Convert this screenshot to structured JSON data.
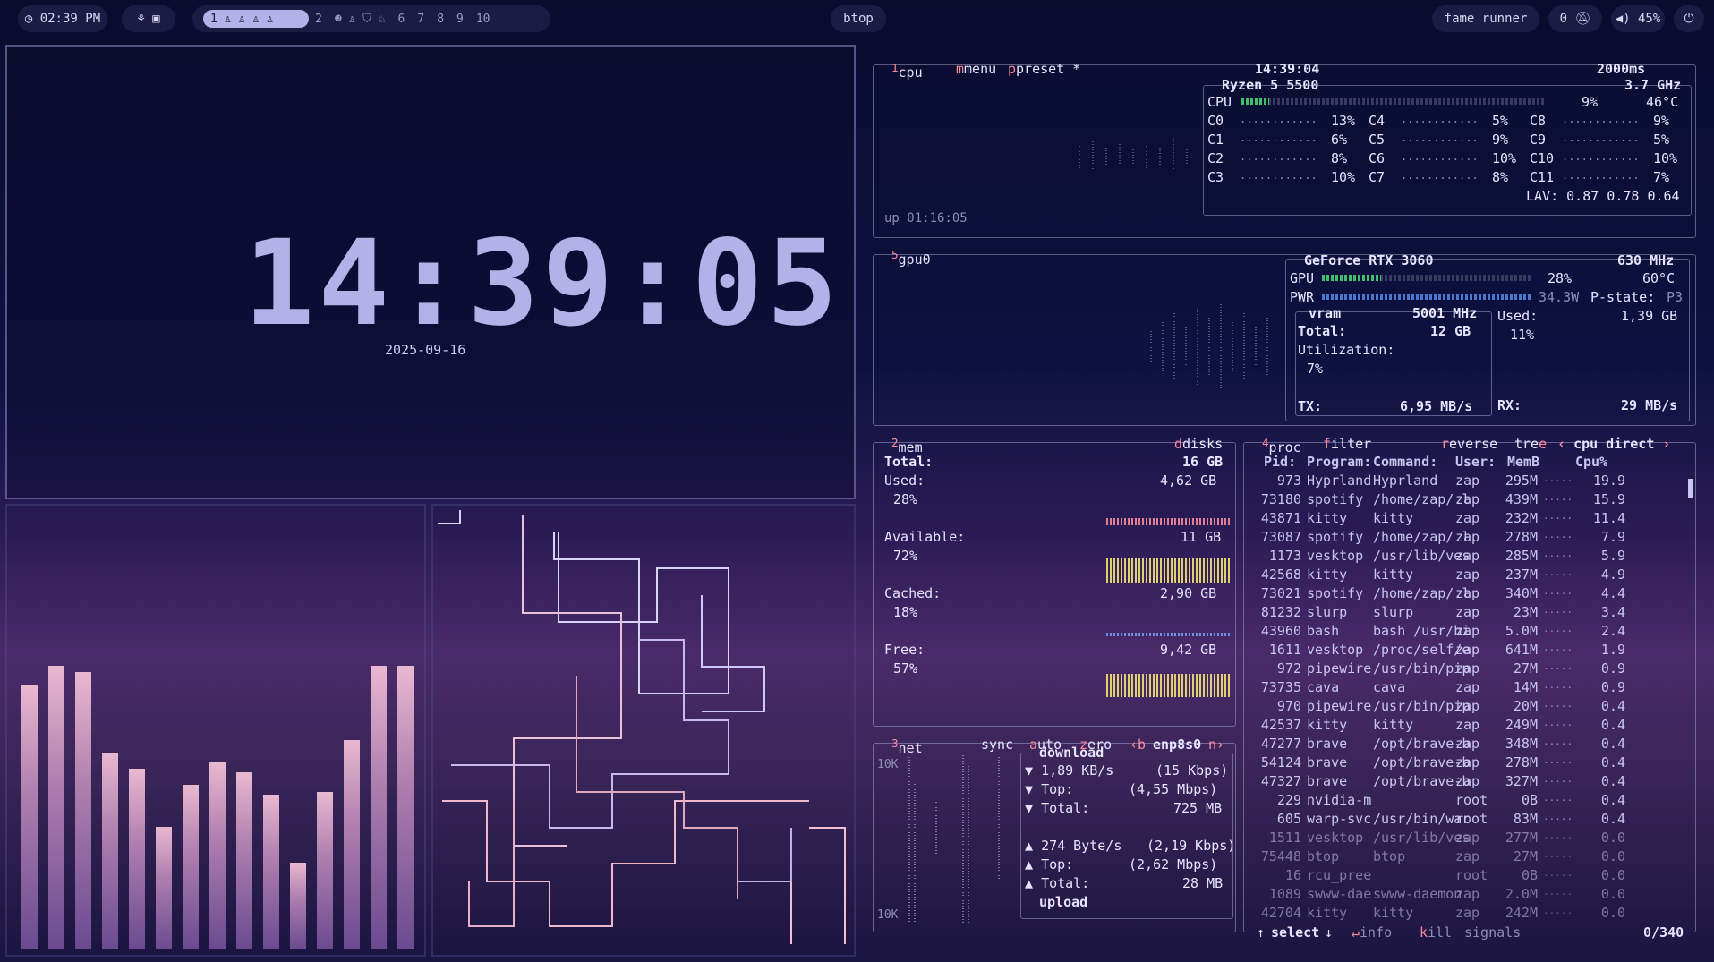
{
  "topbar": {
    "clock": "02:39 PM",
    "workspaces": [
      "1",
      "2",
      "6",
      "7",
      "8",
      "9",
      "10"
    ],
    "active_window": "btop",
    "media": "fame runner",
    "notifications": "0",
    "volume": "45%"
  },
  "clock_widget": {
    "time": "14:39:05",
    "date": "2025-09-16"
  },
  "cpu": {
    "tabs": [
      "cpu",
      "menu",
      "preset *"
    ],
    "time": "14:39:04",
    "interval": "2000ms",
    "model": "Ryzen 5 5500",
    "freq": "3.7 GHz",
    "total_label": "CPU",
    "total_pct": "9%",
    "total_fill": 0.09,
    "temp": "46°C",
    "cores": [
      {
        "name": "C0",
        "pct": "13%"
      },
      {
        "name": "C1",
        "pct": "6%"
      },
      {
        "name": "C2",
        "pct": "8%"
      },
      {
        "name": "C3",
        "pct": "10%"
      },
      {
        "name": "C4",
        "pct": "5%"
      },
      {
        "name": "C5",
        "pct": "9%"
      },
      {
        "name": "C6",
        "pct": "10%"
      },
      {
        "name": "C7",
        "pct": "8%"
      },
      {
        "name": "C8",
        "pct": "9%"
      },
      {
        "name": "C9",
        "pct": "5%"
      },
      {
        "name": "C10",
        "pct": "10%"
      },
      {
        "name": "C11",
        "pct": "7%"
      }
    ],
    "lav": "LAV: 0.87 0.78 0.64",
    "uptime": "up 01:16:05"
  },
  "gpu": {
    "title": "gpu0",
    "model": "GeForce RTX 3060",
    "clock": "630 MHz",
    "gpu_label": "GPU",
    "gpu_pct": "28%",
    "gpu_fill": 0.28,
    "temp": "60°C",
    "pwr_label": "PWR",
    "pwr_val": "34.3W",
    "pstate": "P-state:",
    "pstate_val": "P3",
    "vram_title": "vram",
    "vram_clock": "5001 MHz",
    "total_label": "Total:",
    "total_val": "12 GB",
    "util_label": "Utilization:",
    "util_val": "7%",
    "used_label": "Used:",
    "used_val": "1,39 GB",
    "used_pct": "11%",
    "tx_label": "TX:",
    "tx_val": "6,95 MB/s",
    "rx_label": "RX:",
    "rx_val": "29 MB/s"
  },
  "mem": {
    "title": "mem",
    "disks": "disks",
    "total_label": "Total:",
    "total_val": "16 GB",
    "used_label": "Used:",
    "used_val": "4,62 GB",
    "used_pct": "28%",
    "avail_label": "Available:",
    "avail_val": "11 GB",
    "avail_pct": "72%",
    "cached_label": "Cached:",
    "cached_val": "2,90 GB",
    "cached_pct": "18%",
    "free_label": "Free:",
    "free_val": "9,42 GB",
    "free_pct": "57%"
  },
  "net": {
    "title": "net",
    "tabs": [
      "sync",
      "auto",
      "zero",
      "b",
      "enp8s0",
      "n"
    ],
    "scale_top": "10K",
    "scale_bottom": "10K",
    "download": "download",
    "dl_rate": "1,89 KB/s",
    "dl_rate_bits": "(15 Kbps)",
    "dl_top_label": "Top:",
    "dl_top": "(4,55 Mbps)",
    "dl_total_label": "Total:",
    "dl_total": "725 MB",
    "ul_rate": "274 Byte/s",
    "ul_rate_bits": "(2,19 Kbps)",
    "ul_top_label": "Top:",
    "ul_top": "(2,62 Mbps)",
    "ul_total_label": "Total:",
    "ul_total": "28 MB",
    "upload": "upload"
  },
  "proc": {
    "tabs": [
      "proc",
      "filter",
      "reverse",
      "tree",
      "cpu direct"
    ],
    "headers": [
      "Pid:",
      "Program:",
      "Command:",
      "User:",
      "MemB",
      "Cpu%"
    ],
    "rows": [
      [
        "973",
        "Hyprland",
        "Hyprland",
        "zap",
        "295M",
        "19.9"
      ],
      [
        "73180",
        "spotify",
        "/home/zap/.l",
        "zap",
        "439M",
        "15.9"
      ],
      [
        "43871",
        "kitty",
        "kitty",
        "zap",
        "232M",
        "11.4"
      ],
      [
        "73087",
        "spotify",
        "/home/zap/.l",
        "zap",
        "278M",
        "7.9"
      ],
      [
        "1173",
        "vesktop",
        "/usr/lib/ves",
        "zap",
        "285M",
        "5.9"
      ],
      [
        "42568",
        "kitty",
        "kitty",
        "zap",
        "237M",
        "4.9"
      ],
      [
        "73021",
        "spotify",
        "/home/zap/.l",
        "zap",
        "340M",
        "4.4"
      ],
      [
        "81232",
        "slurp",
        "slurp",
        "zap",
        "23M",
        "3.4"
      ],
      [
        "43960",
        "bash",
        "bash /usr/bi",
        "zap",
        "5.0M",
        "2.4"
      ],
      [
        "1611",
        "vesktop",
        "/proc/self/e",
        "zap",
        "641M",
        "1.9"
      ],
      [
        "972",
        "pipewire",
        "/usr/bin/pip",
        "zap",
        "27M",
        "0.9"
      ],
      [
        "73735",
        "cava",
        "cava",
        "zap",
        "14M",
        "0.9"
      ],
      [
        "970",
        "pipewire",
        "/usr/bin/pip",
        "zap",
        "20M",
        "0.4"
      ],
      [
        "42537",
        "kitty",
        "kitty",
        "zap",
        "249M",
        "0.4"
      ],
      [
        "47277",
        "brave",
        "/opt/brave-b",
        "zap",
        "348M",
        "0.4"
      ],
      [
        "54124",
        "brave",
        "/opt/brave-b",
        "zap",
        "278M",
        "0.4"
      ],
      [
        "47327",
        "brave",
        "/opt/brave-b",
        "zap",
        "327M",
        "0.4"
      ],
      [
        "229",
        "nvidia-m",
        "",
        "root",
        "0B",
        "0.4"
      ],
      [
        "605",
        "warp-svc",
        "/usr/bin/war",
        "root",
        "83M",
        "0.4"
      ],
      [
        "1511",
        "vesktop",
        "/usr/lib/ves",
        "zap",
        "277M",
        "0.0"
      ],
      [
        "75448",
        "btop",
        "btop",
        "zap",
        "27M",
        "0.0"
      ],
      [
        "16",
        "rcu_pree",
        "",
        "root",
        "0B",
        "0.0"
      ],
      [
        "1089",
        "swww-dae",
        "swww-daemon",
        "zap",
        "2.0M",
        "0.0"
      ],
      [
        "42704",
        "kitty",
        "kitty",
        "zap",
        "242M",
        "0.0"
      ]
    ],
    "footer": [
      "select",
      "info",
      "kill",
      "signals"
    ],
    "count": "0/340"
  },
  "cava": {
    "levels": [
      0.82,
      0.88,
      0.86,
      0.61,
      0.56,
      0.38,
      0.51,
      0.58,
      0.55,
      0.48,
      0.27,
      0.49,
      0.65,
      0.88,
      0.88
    ]
  },
  "colors": {
    "accent": "#b4b0e8",
    "green": "#3ec06d",
    "red": "#ff6b8a"
  }
}
